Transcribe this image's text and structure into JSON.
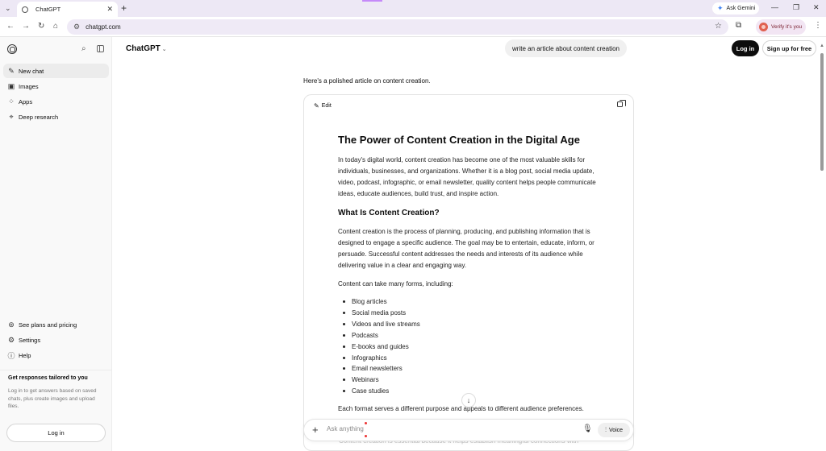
{
  "browser": {
    "tab_title": "ChatGPT",
    "tab_close": "✕",
    "new_tab": "+",
    "ask_gemini": "Ask Gemini",
    "url": "chatgpt.com",
    "verify": "Verify it's you"
  },
  "sidebar": {
    "items": [
      {
        "label": "New chat",
        "icon": "edit-icon"
      },
      {
        "label": "Images",
        "icon": "image-icon"
      },
      {
        "label": "Apps",
        "icon": "apps-grid-icon"
      },
      {
        "label": "Deep research",
        "icon": "telescope-icon"
      }
    ],
    "bottom_items": [
      {
        "label": "See plans and pricing",
        "icon": "plans-icon"
      },
      {
        "label": "Settings",
        "icon": "gear-icon"
      },
      {
        "label": "Help",
        "icon": "help-icon"
      }
    ],
    "tail_title": "Get responses tailored to you",
    "tail_desc": "Log in to get answers based on saved chats, plus create images and upload files.",
    "login": "Log in"
  },
  "header": {
    "model": "ChatGPT",
    "user_message": "write an article about content creation",
    "login": "Log in",
    "signup": "Sign up for free"
  },
  "response": {
    "intro": "Here's a polished article on content creation.",
    "edit_label": "Edit",
    "title": "The Power of Content Creation in the Digital Age",
    "p1": "In today's digital world, content creation has become one of the most valuable skills for individuals, businesses, and organizations. Whether it is a blog post, social media update, video, podcast, infographic, or email newsletter, quality content helps people communicate ideas, educate audiences, build trust, and inspire action.",
    "h2": "What Is Content Creation?",
    "p2": "Content creation is the process of planning, producing, and publishing information that is designed to engage a specific audience. The goal may be to entertain, educate, inform, or persuade. Successful content addresses the needs and interests of its audience while delivering value in a clear and engaging way.",
    "p3": "Content can take many forms, including:",
    "list": [
      "Blog articles",
      "Social media posts",
      "Videos and live streams",
      "Podcasts",
      "E-books and guides",
      "Infographics",
      "Email newsletters",
      "Webinars",
      "Case studies"
    ],
    "p4": "Each format serves a different purpose and appeals to different audience preferences.",
    "p5_partial": "Content creation is essential because it helps establish meaningful connections with"
  },
  "composer": {
    "placeholder": "Ask anything",
    "voice": "Voice"
  }
}
